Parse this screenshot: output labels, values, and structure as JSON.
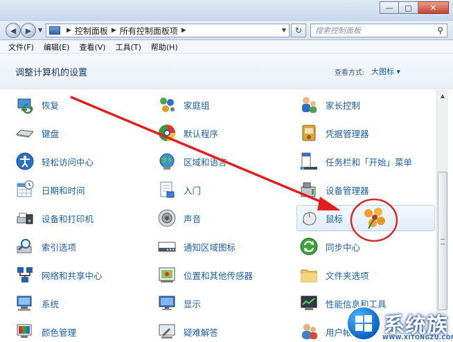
{
  "window": {
    "controls": {
      "minimize": "—",
      "maximize": "□",
      "close": "✕"
    }
  },
  "addressbar": {
    "breadcrumbs": [
      "控制面板",
      "所有控制面板项"
    ],
    "search_placeholder": "搜索控制面板",
    "icons": {
      "back": "arrow-left-icon",
      "forward": "arrow-right-icon",
      "refresh": "refresh-icon",
      "search": "search-icon"
    }
  },
  "menu": [
    "文件(F)",
    "编辑(E)",
    "查看(V)",
    "工具(T)",
    "帮助(H)"
  ],
  "header": {
    "title": "调整计算机的设置",
    "view_label": "查看方式:",
    "view_value": "大图标 ▾"
  },
  "items": [
    {
      "label": "恢复",
      "icon": "recovery-icon"
    },
    {
      "label": "家庭组",
      "icon": "homegroup-icon"
    },
    {
      "label": "家长控制",
      "icon": "parental-controls-icon"
    },
    {
      "label": "键盘",
      "icon": "keyboard-icon"
    },
    {
      "label": "默认程序",
      "icon": "default-programs-icon"
    },
    {
      "label": "凭据管理器",
      "icon": "credential-manager-icon"
    },
    {
      "label": "轻松访问中心",
      "icon": "ease-of-access-icon"
    },
    {
      "label": "区域和语言",
      "icon": "region-language-icon"
    },
    {
      "label": "任务栏和「开始」菜单",
      "icon": "taskbar-start-menu-icon"
    },
    {
      "label": "日期和时间",
      "icon": "date-time-icon"
    },
    {
      "label": "入门",
      "icon": "getting-started-icon"
    },
    {
      "label": "设备管理器",
      "icon": "device-manager-icon"
    },
    {
      "label": "设备和打印机",
      "icon": "devices-printers-icon"
    },
    {
      "label": "声音",
      "icon": "sound-icon"
    },
    {
      "label": "鼠标",
      "icon": "mouse-icon"
    },
    {
      "label": "索引选项",
      "icon": "indexing-options-icon"
    },
    {
      "label": "通知区域图标",
      "icon": "notification-area-icon"
    },
    {
      "label": "同步中心",
      "icon": "sync-center-icon"
    },
    {
      "label": "网络和共享中心",
      "icon": "network-sharing-icon"
    },
    {
      "label": "位置和其他传感器",
      "icon": "location-sensors-icon"
    },
    {
      "label": "文件夹选项",
      "icon": "folder-options-icon"
    },
    {
      "label": "系统",
      "icon": "system-icon"
    },
    {
      "label": "显示",
      "icon": "display-icon"
    },
    {
      "label": "性能信息和工具",
      "icon": "performance-icon"
    },
    {
      "label": "颜色管理",
      "icon": "color-management-icon"
    },
    {
      "label": "疑难解答",
      "icon": "troubleshooting-icon"
    },
    {
      "label": "用户帐户",
      "icon": "user-accounts-icon"
    }
  ],
  "selected_item": "鼠标",
  "watermark": {
    "text": "系统族",
    "url": "WWW.XITONGZU.COM"
  },
  "colors": {
    "link": "#1d5e9e",
    "annotation": "#e02020",
    "header_bg": "#eaf1fa"
  }
}
